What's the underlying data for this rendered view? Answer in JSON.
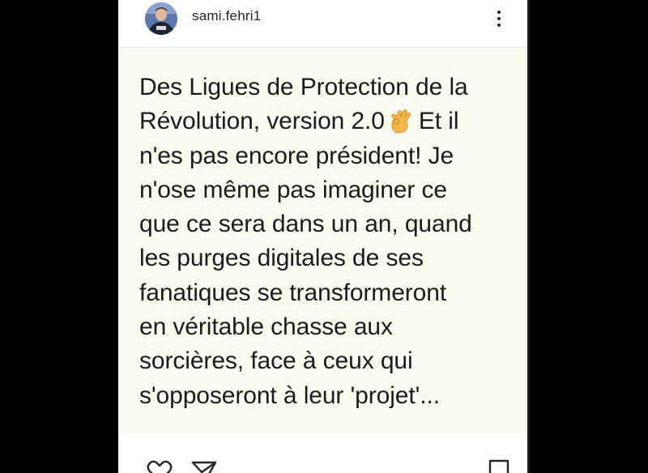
{
  "post": {
    "username": "sami.fehri1",
    "text_before_emoji": "Des Ligues de Protection de la\nRévolution, version 2.0",
    "emoji": "👌",
    "text_after_emoji": "Et il\nn'es pas encore président! Je\nn'ose même pas imaginer ce\nque ce sera dans un an, quand\nles purges digitales de ses\nfanatiques se transformeront\nen véritable chasse aux\nsorcières, face à ceux qui\ns'opposeront à leur 'projet'..."
  },
  "icons": {
    "more": "more-vertical-icon",
    "like": "heart-icon",
    "share": "paper-plane-icon",
    "save": "bookmark-icon",
    "emoji": "ok-hand-icon"
  },
  "colors": {
    "post_background": "#fcfbf1",
    "text": "#1b1b1b",
    "outer_background": "#000000"
  }
}
